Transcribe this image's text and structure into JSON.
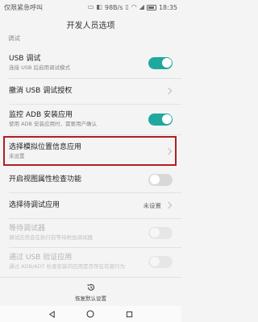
{
  "status": {
    "left_text": "仅限紧急呼叫",
    "signal_text": "98B/s",
    "time": "18:35"
  },
  "title": "开发人员选项",
  "section_header": "调试",
  "rows": [
    {
      "title": "USB 调试",
      "sub": "连接 USB 后启用调试模式",
      "control": "toggle-on"
    },
    {
      "title": "撤消 USB 调试授权",
      "sub": "",
      "control": "chevron"
    },
    {
      "title": "监控 ADB 安装应用",
      "sub": "使用 ADB 安装应用时，需要用户确认",
      "control": "toggle-on"
    },
    {
      "title": "选择模拟位置信息应用",
      "sub": "未设置",
      "control": "chevron"
    },
    {
      "title": "开启视图属性检查功能",
      "sub": "",
      "control": "toggle-off"
    },
    {
      "title": "选择待调试应用",
      "value": "未设置",
      "control": "chevron"
    },
    {
      "title": "等待调试器",
      "sub": "调试应用会在执行前等待附加调试器",
      "control": "toggle-disabled"
    },
    {
      "title": "通过 USB 验证应用",
      "sub": "通过 ADB/ADT 检查安装的应用是否存在有害行为",
      "control": "toggle-disabled"
    }
  ],
  "restore_label": "恢复默认设置",
  "colors": {
    "accent": "#1fa7a0",
    "highlight": "#b01e23"
  }
}
